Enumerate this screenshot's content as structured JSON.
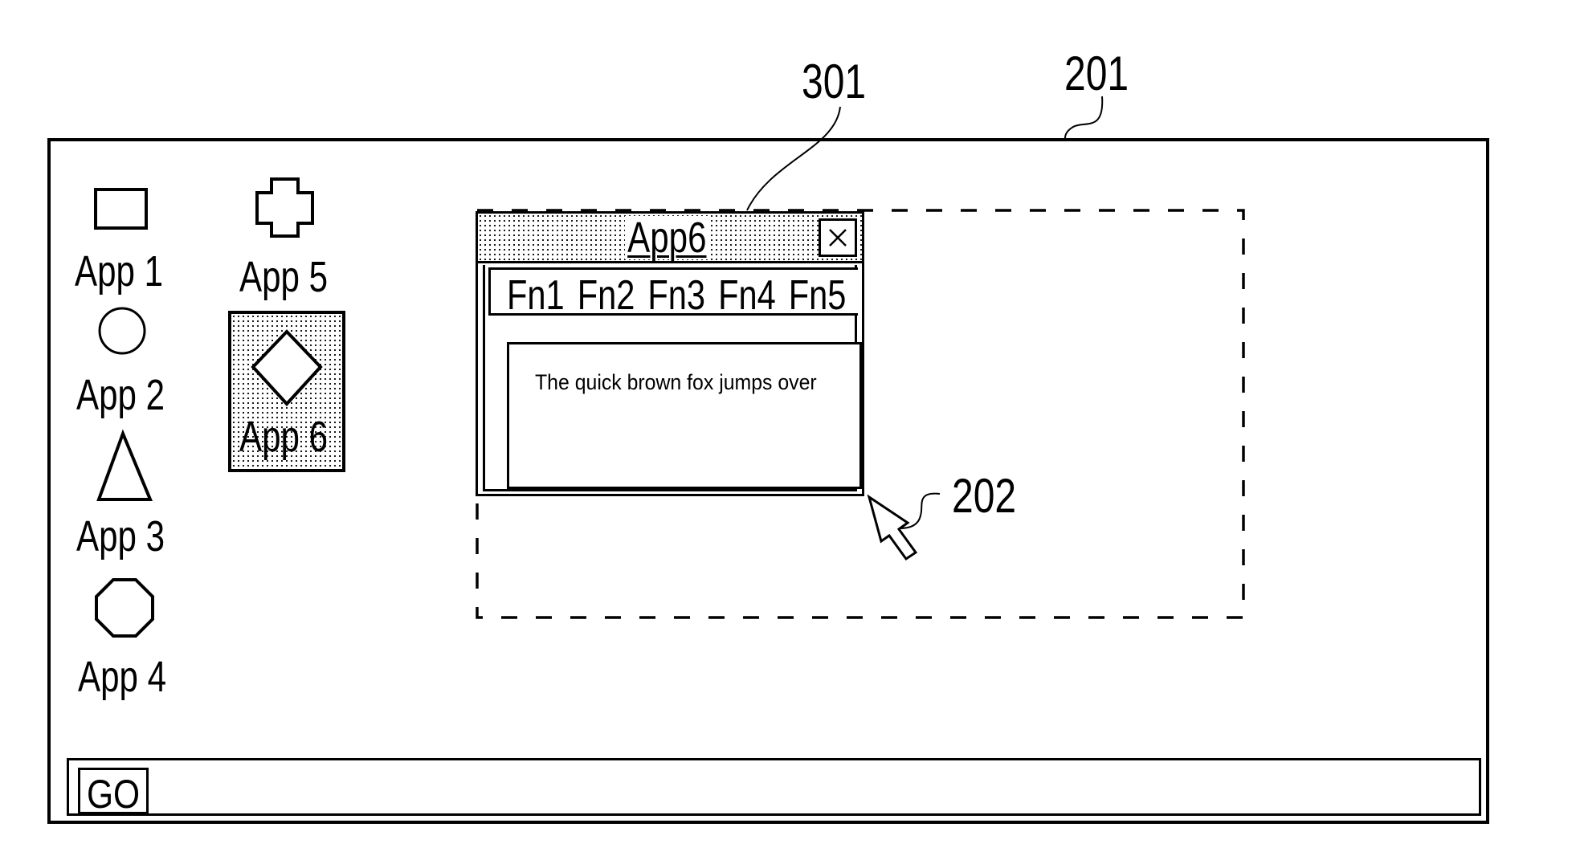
{
  "callouts": {
    "window_title_ref": "301",
    "screen_ref": "201",
    "cursor_ref": "202"
  },
  "desktop": {
    "icons": [
      {
        "label": "App 1",
        "icon": "rectangle-icon"
      },
      {
        "label": "App 2",
        "icon": "circle-icon"
      },
      {
        "label": "App 3",
        "icon": "triangle-icon"
      },
      {
        "label": "App 4",
        "icon": "octagon-icon"
      },
      {
        "label": "App 5",
        "icon": "cross-icon"
      },
      {
        "label": "App 6",
        "icon": "diamond-icon",
        "selected": true
      }
    ]
  },
  "window": {
    "title": "App6",
    "close_icon": "close-icon",
    "menu": [
      "Fn1",
      "Fn2",
      "Fn3",
      "Fn4",
      "Fn5"
    ],
    "document_text": "The quick brown fox jumps over"
  },
  "taskbar": {
    "go_label": "GO"
  },
  "colors": {
    "ink": "#000000",
    "background": "#ffffff"
  }
}
